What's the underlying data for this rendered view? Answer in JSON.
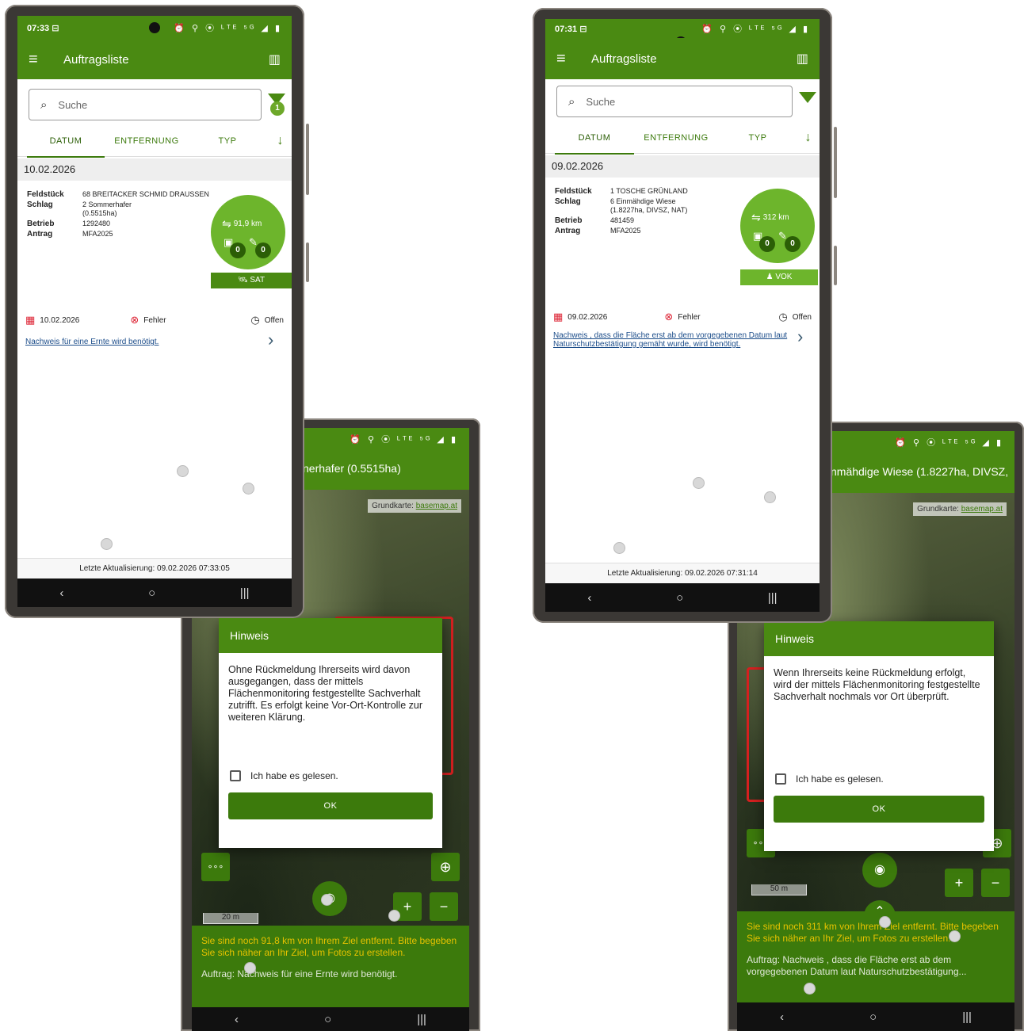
{
  "left": {
    "status": {
      "time": "07:33 ⊟",
      "icons": "⏰ ⚲ ⦿ ᴸᵀᴱ ⁵ᴳ ◢ ▮"
    },
    "appbar": {
      "title": "Auftragsliste"
    },
    "search": {
      "placeholder": "Suche"
    },
    "filter_badge": "1",
    "tabs": [
      "DATUM",
      "ENTFERNUNG",
      "TYP"
    ],
    "date_group": "10.02.2026",
    "fields": {
      "feldstueck_label": "Feldstück",
      "feldstueck": "68  BREITACKER SCHMID DRAUSSEN",
      "schlag_label": "Schlag",
      "schlag": "2  Sommerhafer (0.5515ha)",
      "betrieb_label": "Betrieb",
      "betrieb": "1292480",
      "antrag_label": "Antrag",
      "antrag": "MFA2025"
    },
    "distance": "91,9 km",
    "photo_count": "0",
    "edit_count": "0",
    "tag": "SAT",
    "status_date": "10.02.2026",
    "status_error": "Fehler",
    "status_state": "Offen",
    "link": "Nachweis für eine Ernte wird benötigt.",
    "footer": "Letzte Aktualisierung: 09.02.2026 07:33:05"
  },
  "right": {
    "status": {
      "time": "07:31 ⊟",
      "icons": "⏰ ⚲ ⦿ ᴸᵀᴱ ⁵ᴳ ◢ ▮"
    },
    "appbar": {
      "title": "Auftragsliste"
    },
    "search": {
      "placeholder": "Suche"
    },
    "tabs": [
      "DATUM",
      "ENTFERNUNG",
      "TYP"
    ],
    "date_group": "09.02.2026",
    "fields": {
      "feldstueck_label": "Feldstück",
      "feldstueck": "1  TOSCHE GRÜNLAND",
      "schlag_label": "Schlag",
      "schlag": "6  Einmähdige Wiese (1.8227ha, DIVSZ, NAT)",
      "betrieb_label": "Betrieb",
      "betrieb": "481459",
      "antrag_label": "Antrag",
      "antrag": "MFA2025"
    },
    "distance": "312 km",
    "photo_count": "0",
    "edit_count": "0",
    "tag": "VOK",
    "status_date": "09.02.2026",
    "status_error": "Fehler",
    "status_state": "Offen",
    "link": "Nachweis , dass die Fläche erst ab dem vorgegebenen Datum laut Naturschutzbestätigung gemäht wurde, wird benötigt.",
    "footer": "Letzte Aktualisierung: 09.02.2026 07:31:14"
  },
  "map_left": {
    "title": "nerhafer (0.5515ha)",
    "grundkarte": "Grundkarte:",
    "basemap": "basemap.at",
    "scale": "20 m",
    "dialog": {
      "title": "Hinweis",
      "body": "Ohne Rückmeldung Ihrerseits wird davon ausgegangen, dass der mittels Flächenmonitoring festgestellte Sachverhalt zutrifft. Es erfolgt keine Vor-Ort-Kontrolle zur weiteren Klärung.",
      "check": "Ich habe es gelesen.",
      "ok": "OK"
    },
    "warning": "Sie sind noch 91,8 km von Ihrem Ziel entfernt. Bitte begeben Sie sich näher an Ihr Ziel, um Fotos zu erstellen.",
    "auftrag": "Auftrag: Nachweis für eine Ernte wird benötigt."
  },
  "map_right": {
    "title": "nmähdige Wiese (1.8227ha, DIVSZ,",
    "grundkarte": "Grundkarte:",
    "basemap": "basemap.at",
    "scale": "50 m",
    "dialog": {
      "title": "Hinweis",
      "body": "Wenn Ihrerseits keine Rückmeldung erfolgt, wird der mittels Flächenmonitoring festgestellte Sachverhalt nochmals vor Ort überprüft.",
      "check": "Ich habe es gelesen.",
      "ok": "OK"
    },
    "warning": "Sie sind noch 311 km von Ihrem Ziel entfernt. Bitte begeben Sie sich näher an Ihr Ziel, um Fotos zu erstellen.",
    "auftrag": "Auftrag: Nachweis , dass die Fläche erst ab dem vorgegebenen Datum laut Naturschutzbestätigung..."
  },
  "icons": {
    "nav_back": "‹",
    "nav_home": "○",
    "nav_recent": "|||",
    "menu": "≡",
    "map": "▥",
    "search": "⌕",
    "sort": "↓",
    "chevron": "›",
    "camera": "◉",
    "up": "⌃",
    "plus": "+",
    "minus": "−",
    "locate": "⊕",
    "more": "∘∘∘"
  },
  "colors": {
    "primary": "#4a8a12",
    "dark": "#3c7a0c",
    "circle": "#6db52c",
    "error": "#dd2233",
    "warn_text": "#e6c200"
  }
}
